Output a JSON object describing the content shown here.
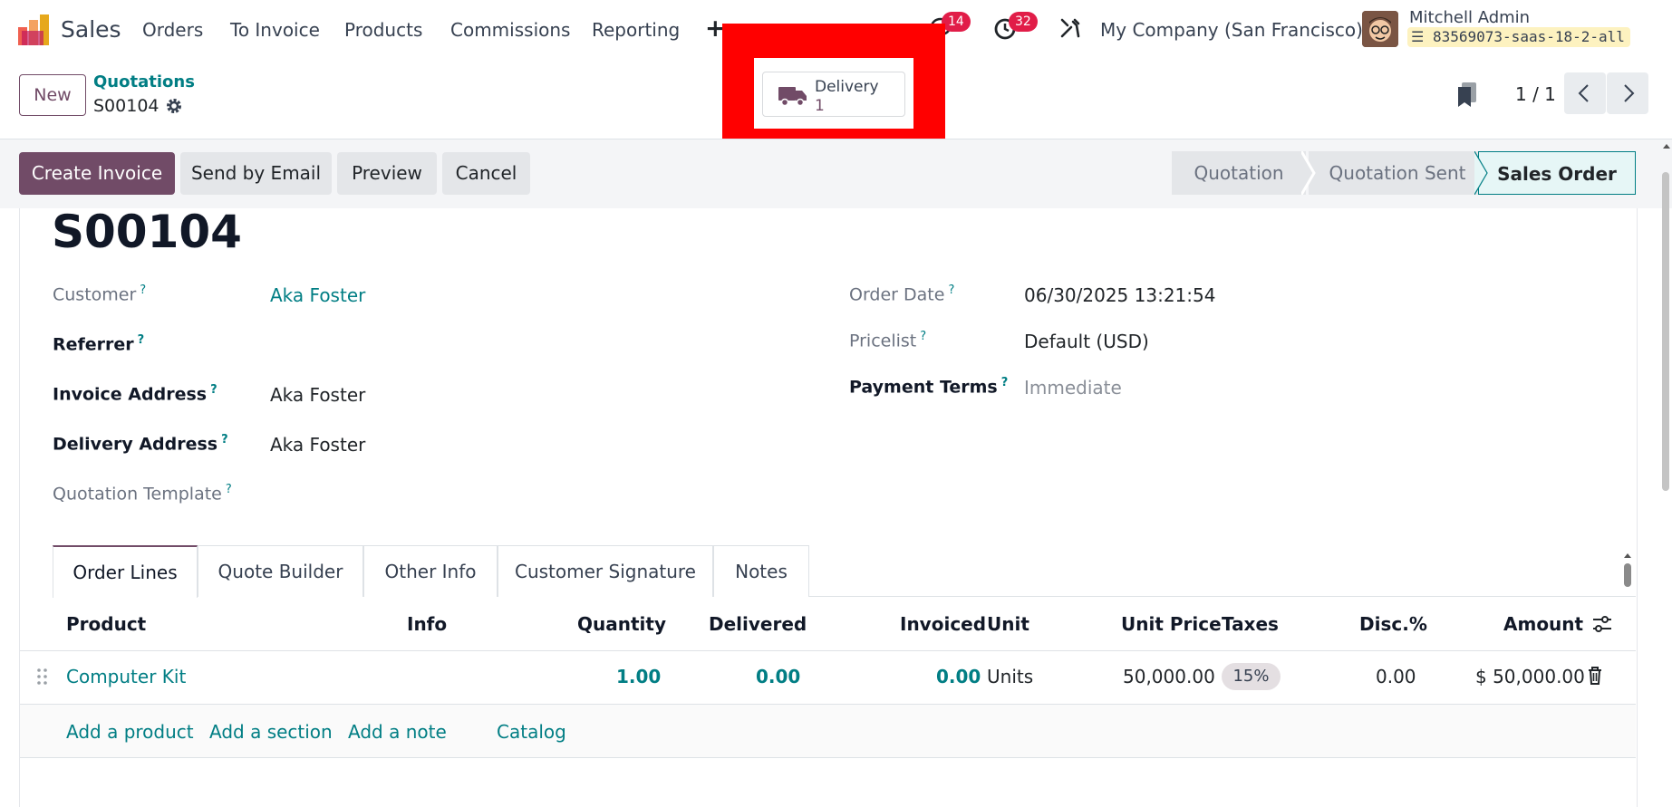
{
  "navbar": {
    "app_name": "Sales",
    "menus": [
      "Orders",
      "To Invoice",
      "Products",
      "Commissions",
      "Reporting"
    ],
    "plus": "+",
    "messages_count": "14",
    "activities_count": "32",
    "company": "My Company (San Francisco)",
    "user_name": "Mitchell Admin",
    "database": "83569073-saas-18-2-all"
  },
  "control_panel": {
    "new_label": "New",
    "breadcrumb": "Quotations",
    "record_name": "S00104",
    "smart_button": {
      "label": "Delivery",
      "value": "1"
    },
    "pager": "1 / 1"
  },
  "actions": {
    "create_invoice": "Create Invoice",
    "send_by_email": "Send by Email",
    "preview": "Preview",
    "cancel": "Cancel"
  },
  "statusbar": [
    "Quotation",
    "Quotation Sent",
    "Sales Order"
  ],
  "form": {
    "title": "S00104",
    "labels": {
      "customer": "Customer",
      "referrer": "Referrer",
      "invoice_address": "Invoice Address",
      "delivery_address": "Delivery Address",
      "quotation_template": "Quotation Template",
      "order_date": "Order Date",
      "pricelist": "Pricelist",
      "payment_terms": "Payment Terms"
    },
    "values": {
      "customer": "Aka Foster",
      "invoice_address": "Aka Foster",
      "delivery_address": "Aka Foster",
      "order_date": "06/30/2025 13:21:54",
      "pricelist": "Default (USD)",
      "payment_terms": "Immediate"
    },
    "help_mark": "?"
  },
  "tabs": [
    "Order Lines",
    "Quote Builder",
    "Other Info",
    "Customer Signature",
    "Notes"
  ],
  "order_lines": {
    "headers": {
      "product": "Product",
      "info": "Info",
      "quantity": "Quantity",
      "delivered": "Delivered",
      "invoiced": "Invoiced",
      "unit": "Unit",
      "unit_price": "Unit Price",
      "taxes": "Taxes",
      "discount": "Disc.%",
      "amount": "Amount"
    },
    "rows": [
      {
        "product": "Computer Kit",
        "quantity": "1.00",
        "delivered": "0.00",
        "invoiced": "0.00",
        "unit": "Units",
        "unit_price": "50,000.00",
        "taxes": "15%",
        "discount": "0.00",
        "amount": "$ 50,000.00"
      }
    ],
    "add_links": {
      "add_product": "Add a product",
      "add_section": "Add a section",
      "add_note": "Add a note",
      "catalog": "Catalog"
    }
  },
  "colors": {
    "brand": "#714b67",
    "link": "#017e84",
    "badge": "#e11d48",
    "highlight": "#ff0000"
  }
}
